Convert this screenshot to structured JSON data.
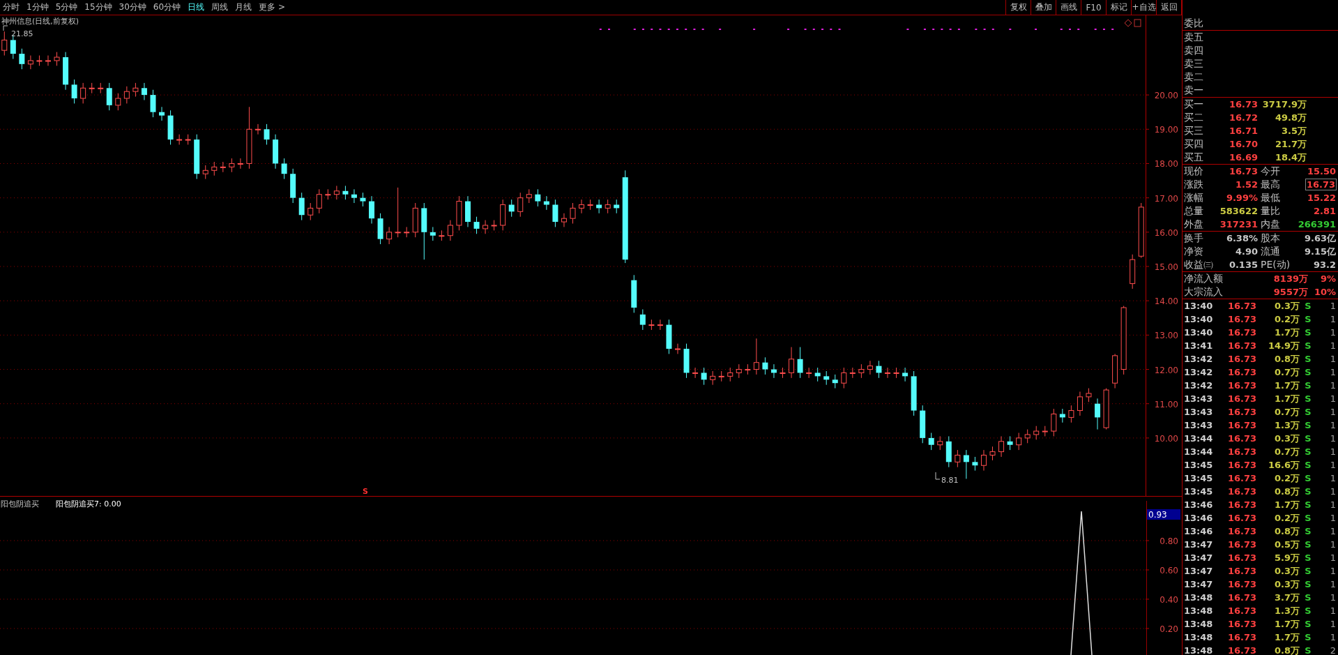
{
  "toolbar": {
    "periods": [
      {
        "label": "分时",
        "selected": false
      },
      {
        "label": "1分钟",
        "selected": false
      },
      {
        "label": "5分钟",
        "selected": false
      },
      {
        "label": "15分钟",
        "selected": false
      },
      {
        "label": "30分钟",
        "selected": false
      },
      {
        "label": "60分钟",
        "selected": false
      },
      {
        "label": "日线",
        "selected": true
      },
      {
        "label": "周线",
        "selected": false
      },
      {
        "label": "月线",
        "selected": false
      },
      {
        "label": "更多 >",
        "selected": false
      }
    ],
    "buttons": [
      "复权",
      "叠加",
      "画线",
      "F10",
      "标记",
      "+自选",
      "返回"
    ]
  },
  "chart": {
    "title": "神州信息(日线,前复权)",
    "high_label": "21.85",
    "low_label": "8.81",
    "signal_label": "S",
    "chart_data": {
      "type": "candlestick",
      "grid": true,
      "ylim": [
        8.29,
        22.32
      ],
      "categories": [
        null,
        null,
        null,
        null,
        null,
        null,
        null,
        null,
        null,
        null,
        null,
        null,
        null,
        null,
        null,
        null,
        null,
        null,
        null,
        null,
        null,
        null,
        null,
        null,
        null,
        null,
        null,
        null,
        null,
        null,
        null,
        null,
        null,
        null,
        null,
        null,
        null,
        null,
        null,
        null,
        null,
        null,
        null,
        null,
        null,
        null,
        null,
        null,
        null,
        null,
        null,
        null,
        null,
        null,
        null,
        null,
        null,
        null,
        null,
        null,
        null,
        null,
        null,
        null,
        null,
        null,
        null,
        null,
        null,
        null,
        null,
        null,
        null,
        null,
        null,
        null,
        null,
        null,
        null,
        null,
        null,
        null,
        null,
        null,
        null,
        null,
        null,
        null,
        null,
        null,
        null,
        null,
        null,
        null,
        null,
        null,
        null,
        null,
        null,
        null,
        null,
        null,
        null,
        null,
        null,
        null,
        null,
        null,
        null,
        null,
        null,
        null,
        null,
        null,
        null,
        null,
        null,
        null,
        null,
        null,
        null,
        null,
        null,
        null,
        null,
        null,
        null,
        null,
        null,
        null,
        null
      ],
      "yticks": [
        {
          "value": 20,
          "label": "20.00"
        },
        {
          "value": 19,
          "label": "19.00"
        },
        {
          "value": 18,
          "label": "18.00"
        },
        {
          "value": 17,
          "label": "17.00"
        },
        {
          "value": 16,
          "label": "16.00"
        },
        {
          "value": 15,
          "label": "15.00"
        },
        {
          "value": 14,
          "label": "14.00"
        },
        {
          "value": 13,
          "label": "13.00"
        },
        {
          "value": 12,
          "label": "12.00"
        },
        {
          "value": 11,
          "label": "11.00"
        },
        {
          "value": 10,
          "label": "10.00"
        }
      ],
      "ohlc": [
        [
          21.3,
          21.85,
          21.15,
          21.6
        ],
        [
          21.6,
          21.75,
          21.05,
          21.2
        ],
        [
          21.2,
          21.35,
          20.75,
          20.9
        ],
        [
          20.9,
          21.15,
          20.75,
          21.0
        ],
        [
          21.0,
          21.15,
          20.85,
          21.0
        ],
        [
          21.0,
          21.15,
          20.85,
          21.0
        ],
        [
          21.0,
          21.25,
          20.85,
          21.1
        ],
        [
          21.1,
          21.25,
          20.15,
          20.3
        ],
        [
          20.3,
          20.45,
          19.75,
          19.9
        ],
        [
          19.9,
          20.35,
          19.75,
          20.2
        ],
        [
          20.2,
          20.35,
          20.05,
          20.2
        ],
        [
          20.2,
          20.35,
          20.05,
          20.2
        ],
        [
          20.2,
          20.35,
          19.55,
          19.7
        ],
        [
          19.7,
          20.05,
          19.55,
          19.9
        ],
        [
          19.9,
          20.25,
          19.75,
          20.1
        ],
        [
          20.1,
          20.35,
          19.95,
          20.2
        ],
        [
          20.2,
          20.35,
          19.85,
          20.0
        ],
        [
          20.0,
          20.15,
          19.35,
          19.5
        ],
        [
          19.5,
          19.65,
          19.25,
          19.4
        ],
        [
          19.4,
          19.55,
          18.55,
          18.7
        ],
        [
          18.7,
          18.85,
          18.55,
          18.7
        ],
        [
          18.7,
          18.85,
          18.55,
          18.7
        ],
        [
          18.7,
          18.85,
          17.55,
          17.7
        ],
        [
          17.7,
          17.95,
          17.55,
          17.8
        ],
        [
          17.8,
          18.05,
          17.65,
          17.9
        ],
        [
          17.9,
          18.05,
          17.75,
          17.9
        ],
        [
          17.9,
          18.15,
          17.75,
          18.0
        ],
        [
          18.0,
          18.15,
          17.85,
          18.0
        ],
        [
          18.0,
          19.65,
          17.85,
          19.0
        ],
        [
          19.0,
          19.15,
          18.85,
          19.0
        ],
        [
          19.0,
          19.15,
          18.55,
          18.7
        ],
        [
          18.7,
          18.85,
          17.85,
          18.0
        ],
        [
          18.0,
          18.15,
          17.55,
          17.7
        ],
        [
          17.7,
          17.85,
          16.85,
          17.0
        ],
        [
          17.0,
          17.15,
          16.35,
          16.5
        ],
        [
          16.5,
          16.85,
          16.35,
          16.7
        ],
        [
          16.7,
          17.25,
          16.55,
          17.1
        ],
        [
          17.1,
          17.25,
          16.95,
          17.1
        ],
        [
          17.1,
          17.35,
          16.95,
          17.2
        ],
        [
          17.2,
          17.35,
          16.95,
          17.1
        ],
        [
          17.1,
          17.25,
          16.85,
          17.0
        ],
        [
          17.0,
          17.15,
          16.75,
          16.9
        ],
        [
          16.9,
          17.05,
          16.25,
          16.4
        ],
        [
          16.4,
          16.55,
          15.65,
          15.8
        ],
        [
          15.8,
          16.15,
          15.65,
          16.0
        ],
        [
          16.0,
          17.3,
          15.85,
          16.0
        ],
        [
          16.0,
          16.15,
          15.85,
          16.0
        ],
        [
          16.0,
          16.85,
          15.85,
          16.7
        ],
        [
          16.7,
          16.85,
          15.2,
          16.0
        ],
        [
          16.0,
          16.15,
          15.75,
          15.9
        ],
        [
          15.9,
          16.05,
          15.75,
          15.9
        ],
        [
          15.9,
          16.35,
          15.75,
          16.2
        ],
        [
          16.2,
          17.05,
          16.05,
          16.9
        ],
        [
          16.9,
          17.05,
          16.15,
          16.3
        ],
        [
          16.3,
          16.45,
          15.95,
          16.1
        ],
        [
          16.1,
          16.35,
          15.95,
          16.2
        ],
        [
          16.2,
          16.35,
          16.05,
          16.2
        ],
        [
          16.2,
          16.95,
          16.05,
          16.8
        ],
        [
          16.8,
          16.95,
          16.45,
          16.6
        ],
        [
          16.6,
          17.15,
          16.45,
          17.0
        ],
        [
          17.0,
          17.25,
          16.85,
          17.1
        ],
        [
          17.1,
          17.25,
          16.75,
          16.9
        ],
        [
          16.9,
          17.05,
          16.65,
          16.8
        ],
        [
          16.8,
          16.95,
          16.15,
          16.3
        ],
        [
          16.3,
          16.55,
          16.15,
          16.4
        ],
        [
          16.4,
          16.85,
          16.25,
          16.7
        ],
        [
          16.7,
          16.95,
          16.55,
          16.8
        ],
        [
          16.8,
          16.95,
          16.65,
          16.8
        ],
        [
          16.8,
          16.95,
          16.55,
          16.7
        ],
        [
          16.7,
          16.95,
          16.55,
          16.8
        ],
        [
          16.8,
          16.95,
          16.55,
          16.7
        ],
        [
          17.6,
          17.8,
          15.1,
          15.2
        ],
        [
          14.6,
          14.75,
          13.65,
          13.8
        ],
        [
          13.6,
          13.75,
          13.15,
          13.3
        ],
        [
          13.3,
          13.45,
          13.15,
          13.3
        ],
        [
          13.3,
          13.45,
          13.15,
          13.3
        ],
        [
          13.3,
          13.45,
          12.45,
          12.6
        ],
        [
          12.6,
          12.75,
          12.45,
          12.6
        ],
        [
          12.6,
          12.75,
          11.75,
          11.9
        ],
        [
          11.9,
          12.05,
          11.75,
          11.9
        ],
        [
          11.9,
          12.05,
          11.55,
          11.7
        ],
        [
          11.7,
          11.95,
          11.55,
          11.8
        ],
        [
          11.8,
          11.95,
          11.65,
          11.8
        ],
        [
          11.8,
          12.05,
          11.65,
          11.9
        ],
        [
          11.9,
          12.15,
          11.75,
          12.0
        ],
        [
          12.0,
          12.15,
          11.85,
          12.0
        ],
        [
          12.0,
          12.9,
          11.85,
          12.2
        ],
        [
          12.2,
          12.35,
          11.85,
          12.0
        ],
        [
          12.0,
          12.15,
          11.75,
          11.9
        ],
        [
          11.9,
          12.05,
          11.75,
          11.9
        ],
        [
          11.9,
          12.65,
          11.75,
          12.3
        ],
        [
          12.3,
          12.65,
          11.75,
          11.9
        ],
        [
          11.9,
          12.05,
          11.75,
          11.9
        ],
        [
          11.9,
          12.05,
          11.65,
          11.8
        ],
        [
          11.8,
          11.95,
          11.55,
          11.7
        ],
        [
          11.7,
          11.85,
          11.45,
          11.6
        ],
        [
          11.6,
          12.05,
          11.45,
          11.9
        ],
        [
          11.9,
          12.05,
          11.75,
          11.9
        ],
        [
          11.9,
          12.15,
          11.75,
          12.0
        ],
        [
          12.0,
          12.25,
          11.85,
          12.1
        ],
        [
          12.1,
          12.25,
          11.75,
          11.9
        ],
        [
          11.9,
          12.05,
          11.75,
          11.9
        ],
        [
          11.9,
          12.05,
          11.75,
          11.9
        ],
        [
          11.9,
          12.05,
          11.65,
          11.8
        ],
        [
          11.8,
          11.95,
          10.65,
          10.8
        ],
        [
          10.8,
          10.95,
          9.85,
          10.0
        ],
        [
          10.0,
          10.15,
          9.65,
          9.8
        ],
        [
          9.8,
          10.05,
          9.65,
          9.9
        ],
        [
          9.9,
          10.05,
          9.15,
          9.3
        ],
        [
          9.3,
          9.65,
          9.15,
          9.5
        ],
        [
          9.5,
          9.65,
          8.81,
          9.3
        ],
        [
          9.3,
          9.45,
          9.05,
          9.2
        ],
        [
          9.2,
          9.65,
          9.05,
          9.5
        ],
        [
          9.5,
          9.75,
          9.35,
          9.6
        ],
        [
          9.6,
          10.05,
          9.45,
          9.9
        ],
        [
          9.9,
          10.05,
          9.65,
          9.8
        ],
        [
          9.8,
          10.15,
          9.65,
          10.0
        ],
        [
          10.0,
          10.25,
          9.85,
          10.1
        ],
        [
          10.1,
          10.35,
          9.95,
          10.2
        ],
        [
          10.2,
          10.35,
          10.05,
          10.2
        ],
        [
          10.2,
          10.85,
          10.05,
          10.7
        ],
        [
          10.7,
          10.85,
          10.45,
          10.6
        ],
        [
          10.6,
          10.95,
          10.45,
          10.8
        ],
        [
          10.8,
          11.35,
          10.65,
          11.2
        ],
        [
          11.2,
          11.45,
          11.05,
          11.3
        ],
        [
          11.0,
          11.15,
          10.25,
          10.6
        ],
        [
          10.3,
          11.45,
          10.25,
          11.4
        ],
        [
          11.6,
          12.45,
          11.45,
          12.4
        ],
        [
          12.0,
          13.85,
          11.85,
          13.8
        ],
        [
          14.5,
          15.35,
          14.35,
          15.2
        ],
        [
          15.3,
          16.85,
          15.25,
          16.73
        ]
      ]
    }
  },
  "indicator": {
    "name": "阳包阴追买",
    "reading": "阳包阴追买7: 0.00",
    "axis": [
      "0.80",
      "0.60",
      "0.40",
      "0.20"
    ],
    "current_value": "0.93"
  },
  "quote": {
    "ratio_label": "委比",
    "asks": [
      {
        "label": "卖五"
      },
      {
        "label": "卖四"
      },
      {
        "label": "卖三"
      },
      {
        "label": "卖二"
      },
      {
        "label": "卖一"
      }
    ],
    "bids": [
      {
        "label": "买一",
        "price": "16.73",
        "volume": "3717.9万"
      },
      {
        "label": "买二",
        "price": "16.72",
        "volume": "49.8万"
      },
      {
        "label": "买三",
        "price": "16.71",
        "volume": "3.5万"
      },
      {
        "label": "买四",
        "price": "16.70",
        "volume": "21.7万"
      },
      {
        "label": "买五",
        "price": "16.69",
        "volume": "18.4万"
      }
    ],
    "stats": [
      {
        "left": {
          "label": "现价",
          "value": "16.73",
          "color": "#ff4040"
        },
        "right": {
          "label": "今开",
          "value": "15.50",
          "color": "#ff4040",
          "boxed": false
        }
      },
      {
        "left": {
          "label": "涨跌",
          "value": "1.52",
          "color": "#ff4040"
        },
        "right": {
          "label": "最高",
          "value": "16.73",
          "color": "#ff4040",
          "boxed": true
        }
      },
      {
        "left": {
          "label": "涨幅",
          "value": "9.99%",
          "color": "#ff4040"
        },
        "right": {
          "label": "最低",
          "value": "15.22",
          "color": "#ff4040",
          "boxed": false
        }
      },
      {
        "left": {
          "label": "总量",
          "value": "583622",
          "color": "#cccc44"
        },
        "right": {
          "label": "量比",
          "value": "2.81",
          "color": "#ff4040",
          "boxed": false
        }
      },
      {
        "left": {
          "label": "外盘",
          "value": "317231",
          "color": "#ff4040"
        },
        "right": {
          "label": "内盘",
          "value": "266391",
          "color": "#33cc33",
          "boxed": false
        }
      }
    ],
    "fundamentals": [
      {
        "label": "换手",
        "value": "6.38%",
        "label2": "股本",
        "value2": "9.63亿"
      },
      {
        "label": "净资",
        "value": "4.90",
        "label2": "流通",
        "value2": "9.15亿"
      },
      {
        "label": "收益㈢",
        "value": "0.135",
        "label2": "PE(动)",
        "value2": "93.2"
      }
    ],
    "flows": [
      {
        "label": "净流入额",
        "amount": "8139万",
        "percent": "9%"
      },
      {
        "label": "大宗流入",
        "amount": "9557万",
        "percent": "10%"
      }
    ]
  },
  "trades": [
    {
      "time": "13:40",
      "price": "16.73",
      "volume": "0.3万",
      "side": "S",
      "count": "1"
    },
    {
      "time": "13:40",
      "price": "16.73",
      "volume": "0.2万",
      "side": "S",
      "count": "1"
    },
    {
      "time": "13:40",
      "price": "16.73",
      "volume": "1.7万",
      "side": "S",
      "count": "1"
    },
    {
      "time": "13:41",
      "price": "16.73",
      "volume": "14.9万",
      "side": "S",
      "count": "1"
    },
    {
      "time": "13:42",
      "price": "16.73",
      "volume": "0.8万",
      "side": "S",
      "count": "1"
    },
    {
      "time": "13:42",
      "price": "16.73",
      "volume": "0.7万",
      "side": "S",
      "count": "1"
    },
    {
      "time": "13:42",
      "price": "16.73",
      "volume": "1.7万",
      "side": "S",
      "count": "1"
    },
    {
      "time": "13:43",
      "price": "16.73",
      "volume": "1.7万",
      "side": "S",
      "count": "1"
    },
    {
      "time": "13:43",
      "price": "16.73",
      "volume": "0.7万",
      "side": "S",
      "count": "1"
    },
    {
      "time": "13:43",
      "price": "16.73",
      "volume": "1.3万",
      "side": "S",
      "count": "1"
    },
    {
      "time": "13:44",
      "price": "16.73",
      "volume": "0.3万",
      "side": "S",
      "count": "1"
    },
    {
      "time": "13:44",
      "price": "16.73",
      "volume": "0.7万",
      "side": "S",
      "count": "1"
    },
    {
      "time": "13:45",
      "price": "16.73",
      "volume": "16.6万",
      "side": "S",
      "count": "1"
    },
    {
      "time": "13:45",
      "price": "16.73",
      "volume": "0.2万",
      "side": "S",
      "count": "1"
    },
    {
      "time": "13:45",
      "price": "16.73",
      "volume": "0.8万",
      "side": "S",
      "count": "1"
    },
    {
      "time": "13:46",
      "price": "16.73",
      "volume": "1.7万",
      "side": "S",
      "count": "1"
    },
    {
      "time": "13:46",
      "price": "16.73",
      "volume": "0.2万",
      "side": "S",
      "count": "1"
    },
    {
      "time": "13:46",
      "price": "16.73",
      "volume": "0.8万",
      "side": "S",
      "count": "1"
    },
    {
      "time": "13:47",
      "price": "16.73",
      "volume": "0.5万",
      "side": "S",
      "count": "1"
    },
    {
      "time": "13:47",
      "price": "16.73",
      "volume": "5.9万",
      "side": "S",
      "count": "1"
    },
    {
      "time": "13:47",
      "price": "16.73",
      "volume": "0.3万",
      "side": "S",
      "count": "1"
    },
    {
      "time": "13:47",
      "price": "16.73",
      "volume": "0.3万",
      "side": "S",
      "count": "1"
    },
    {
      "time": "13:48",
      "price": "16.73",
      "volume": "3.7万",
      "side": "S",
      "count": "1"
    },
    {
      "time": "13:48",
      "price": "16.73",
      "volume": "1.3万",
      "side": "S",
      "count": "1"
    },
    {
      "time": "13:48",
      "price": "16.73",
      "volume": "1.7万",
      "side": "S",
      "count": "1"
    },
    {
      "time": "13:48",
      "price": "16.73",
      "volume": "1.7万",
      "side": "S",
      "count": "1"
    },
    {
      "time": "13:48",
      "price": "16.73",
      "volume": "0.8万",
      "side": "S",
      "count": "2"
    }
  ]
}
